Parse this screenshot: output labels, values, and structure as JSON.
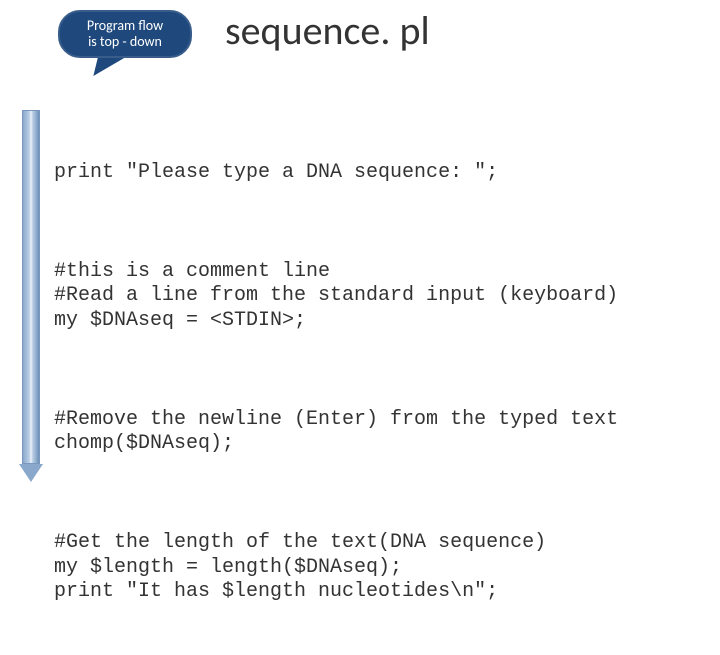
{
  "callout": {
    "line1": "Program flow",
    "line2": "is top - down"
  },
  "title": "sequence. pl",
  "code": {
    "b1": "print \"Please type a DNA sequence: \";",
    "b2": "#this is a comment line\n#Read a line from the standard input (keyboard)\nmy $DNAseq = <STDIN>;",
    "b3": "#Remove the newline (Enter) from the typed text\nchomp($DNAseq);",
    "b4": "#Get the length of the text(DNA sequence)\nmy $length = length($DNAseq);\nprint \"It has $length nucleotides\\n\";"
  }
}
